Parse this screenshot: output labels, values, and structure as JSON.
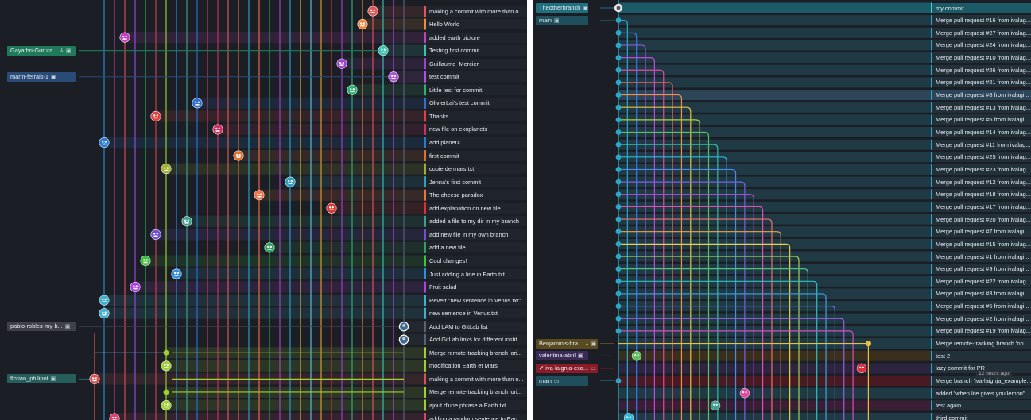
{
  "left": {
    "branches": [
      {
        "text": "Gayathri-Gurura...",
        "row": 3,
        "color": "#1f7a5a",
        "icon": "merge-icon",
        "icon_glyph": "⅄"
      },
      {
        "text": "marin-ferrais-1",
        "row": 5,
        "color": "#2a4a78",
        "icon": "",
        "icon_glyph": ""
      },
      {
        "text": "pablo-robles-my-b...",
        "row": 24,
        "color": "#3f4048",
        "icon": "",
        "icon_glyph": ""
      },
      {
        "text": "florian_philipot",
        "row": 28,
        "color": "#255e5c",
        "icon": "",
        "icon_glyph": ""
      }
    ],
    "commits": [
      {
        "msg": "making a commit with more than o...",
        "color": "#e05757",
        "lane": 26,
        "kind": "avatar"
      },
      {
        "msg": "Hello World",
        "color": "#f08a3c",
        "lane": 25,
        "kind": "avatar"
      },
      {
        "msg": "added earth picture",
        "color": "#c040c0",
        "lane": 2,
        "kind": "avatar"
      },
      {
        "msg": "Testing first commit",
        "color": "#3cc0b0",
        "lane": 27,
        "kind": "avatar"
      },
      {
        "msg": "Guillaume_Mercier",
        "color": "#a040d0",
        "lane": 23,
        "kind": "avatar"
      },
      {
        "msg": "test commit",
        "color": "#b050e0",
        "lane": 28,
        "kind": "avatar"
      },
      {
        "msg": "Little test for commit.",
        "color": "#30b070",
        "lane": 24,
        "kind": "avatar"
      },
      {
        "msg": "OlivierLai's test commit",
        "color": "#3070d0",
        "lane": 9,
        "kind": "avatar"
      },
      {
        "msg": "Thanks",
        "color": "#e04040",
        "lane": 5,
        "kind": "avatar"
      },
      {
        "msg": "new file on exoplanets",
        "color": "#d03060",
        "lane": 11,
        "kind": "avatar"
      },
      {
        "msg": "add planetX",
        "color": "#2a7ad0",
        "lane": 0,
        "kind": "avatar"
      },
      {
        "msg": "first commit",
        "color": "#e07030",
        "lane": 13,
        "kind": "avatar"
      },
      {
        "msg": "copie de mars.txt",
        "color": "#a0b030",
        "lane": 6,
        "kind": "avatar"
      },
      {
        "msg": "Jenna's first commit",
        "color": "#30a0c0",
        "lane": 18,
        "kind": "avatar"
      },
      {
        "msg": "The cheese paradox",
        "color": "#f07040",
        "lane": 15,
        "kind": "avatar"
      },
      {
        "msg": "add explanation on new file",
        "color": "#e03030",
        "lane": 22,
        "kind": "avatar"
      },
      {
        "msg": "added a file to my dir in my branch",
        "color": "#40a090",
        "lane": 8,
        "kind": "avatar"
      },
      {
        "msg": "add new file in my own branch",
        "color": "#7050d0",
        "lane": 5,
        "kind": "avatar"
      },
      {
        "msg": "add a new file",
        "color": "#30a060",
        "lane": 16,
        "kind": "avatar"
      },
      {
        "msg": "Cool changes!",
        "color": "#40c040",
        "lane": 4,
        "kind": "avatar"
      },
      {
        "msg": "Just adding a line in Earth.txt",
        "color": "#3090e0",
        "lane": 7,
        "kind": "avatar"
      },
      {
        "msg": "Fruit salad",
        "color": "#b040e0",
        "lane": 3,
        "kind": "avatar"
      },
      {
        "msg": "Revert \"new sentence in Venus.txt\"",
        "color": "#40b0d0",
        "lane": 0,
        "kind": "avatar"
      },
      {
        "msg": "new sentence in Venus.txt",
        "color": "#40b0d0",
        "lane": 0,
        "kind": "avatar"
      },
      {
        "msg": "Add LAM to GitLab list",
        "color": "#5a6470",
        "lane": 29,
        "kind": "photo"
      },
      {
        "msg": "Add GitLab links for different instit...",
        "color": "#5a6470",
        "lane": 29,
        "kind": "photo"
      },
      {
        "msg": "Merge remote-tracking branch 'ori...",
        "color": "#a0d030",
        "lane": 6,
        "kind": "dot"
      },
      {
        "msg": "modification Earth et Mars",
        "color": "#a0d030",
        "lane": 6,
        "kind": "avatar"
      },
      {
        "msg": "making a commit with more than o...",
        "color": "#e05050",
        "lane": -1,
        "kind": "avatar"
      },
      {
        "msg": "Merge remote-tracking branch 'ori...",
        "color": "#a0d030",
        "lane": 6,
        "kind": "dot"
      },
      {
        "msg": "ajout d'une phrase a Earth.txt",
        "color": "#a0d030",
        "lane": 6,
        "kind": "avatar"
      },
      {
        "msg": "adding a random sentence to Eart...",
        "color": "#e04070",
        "lane": 1,
        "kind": "avatar"
      }
    ]
  },
  "right": {
    "branches": [
      {
        "text": "Theotherbranch",
        "row": 0,
        "color": "#1f6f80",
        "icon": "",
        "icon_glyph": ""
      },
      {
        "text": "main",
        "row": 1,
        "color": "#1f4e5c",
        "icon": "",
        "icon_glyph": ""
      },
      {
        "text": "Benjamin's-bra...",
        "row": 25,
        "color": "#5a4a20",
        "icon": "merge-icon",
        "icon_glyph": "⅄"
      },
      {
        "text": "valentina-abril",
        "row": 26,
        "color": "#3a2a55",
        "icon": "",
        "icon_glyph": ""
      },
      {
        "text": "✔ iva-laignja-exa...",
        "row": 27,
        "color": "#8a1c2a",
        "icon": "laptop-icon",
        "icon_glyph": "▭"
      },
      {
        "text": "main",
        "row": 28,
        "color": "#1f4e5c",
        "icon": "laptop-icon",
        "icon_glyph": "▭"
      }
    ],
    "commits": [
      "my commit",
      "Merge pull request #16 from ivalag...",
      "Merge pull request #27 from ivalag...",
      "Merge pull request #24 from ivalag...",
      "Merge pull request #10 from ivalag...",
      "Merge pull request #26 from ivalag...",
      "Merge pull request #21 from ivalag...",
      "Merge pull request #8 from ivalagi...",
      "Merge pull request #13 from ivalag...",
      "Merge pull request #6 from ivalagi...",
      "Merge pull request #14 from ivalag...",
      "Merge pull request #11 from ivalag...",
      "Merge pull request #25 from ivalag...",
      "Merge pull request #23 from ivalag...",
      "Merge pull request #12 from ivalag...",
      "Merge pull request #18 from ivalag...",
      "Merge pull request #17 from ivalag...",
      "Merge pull request #20 from ivalag...",
      "Merge pull request #7 from ivalagi...",
      "Merge pull request #15 from ivalag...",
      "Merge pull request #1 from ivalagi...",
      "Merge pull request #9 from ivalagi...",
      "Merge pull request #22 from ivalag...",
      "Merge pull request #3 from ivalagi...",
      "Merge pull request #5 from ivalagi...",
      "Merge pull request #2 from ivalagi...",
      "Merge pull request #19 from ivalag...",
      "Merge remote-tracking branch 'ori...",
      "test 2",
      "lazy commit for PR",
      "Merge branch 'iva-laignja_example...",
      "added \"when life gives you lemon\" ...",
      "test again",
      "third commit"
    ],
    "timestamp": "12 hours ago",
    "colors": [
      "#2aa8c8",
      "#3a7ae0",
      "#8a5ae0",
      "#c04ad8",
      "#e04aa0",
      "#f06060",
      "#f0904a",
      "#e8c040",
      "#b0d040",
      "#60c060",
      "#30c0a0",
      "#30b8d8",
      "#4a8ae8",
      "#7a60e8",
      "#b050e0",
      "#e050b0",
      "#f07070",
      "#f0a050",
      "#e8d050",
      "#a0d050",
      "#50c080",
      "#30c0c0",
      "#40a0e0",
      "#6070e8",
      "#9a60e0",
      "#d050c0",
      "#f06080"
    ]
  }
}
